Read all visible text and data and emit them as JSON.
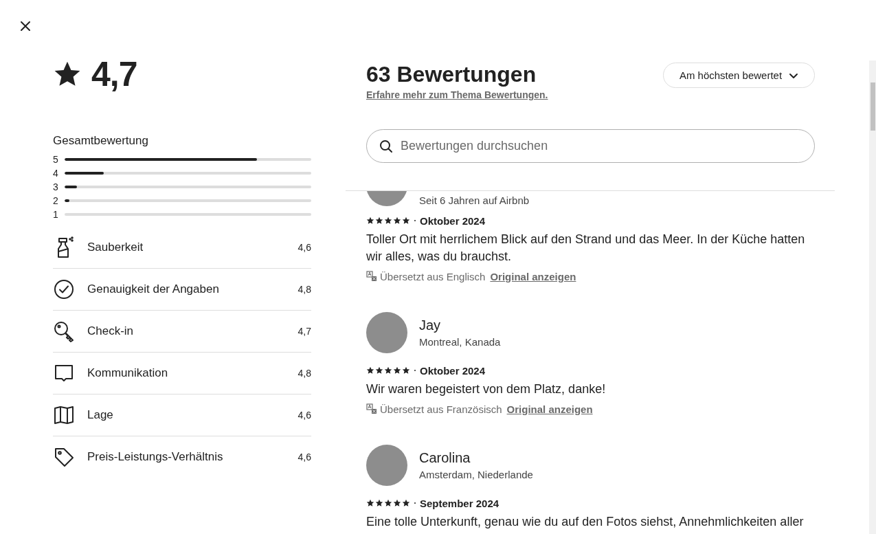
{
  "summary": {
    "rating": "4,7",
    "distribution_title": "Gesamtbewertung",
    "distribution": [
      {
        "label": "5",
        "level": 0.78
      },
      {
        "label": "4",
        "level": 0.16
      },
      {
        "label": "3",
        "level": 0.05
      },
      {
        "label": "2",
        "level": 0.02
      },
      {
        "label": "1",
        "level": 0
      }
    ]
  },
  "categories": [
    {
      "label": "Sauberkeit",
      "score": "4,6"
    },
    {
      "label": "Genauigkeit der Angaben",
      "score": "4,8"
    },
    {
      "label": "Check-in",
      "score": "4,7"
    },
    {
      "label": "Kommunikation",
      "score": "4,8"
    },
    {
      "label": "Lage",
      "score": "4,6"
    },
    {
      "label": "Preis-Leistungs-Verhältnis",
      "score": "4,6"
    }
  ],
  "reviews_header": {
    "title": "63 Bewertungen",
    "link": "Erfahre mehr zum Thema Bewertungen.",
    "sort": {
      "label": "Am höchsten bewertet"
    },
    "search": {
      "placeholder": "Bewertungen durchsuchen"
    }
  },
  "reviews": [
    {
      "subtitle": "Seit 6 Jahren auf Airbnb",
      "stars": 5,
      "date": "Oktober 2024",
      "text": "Toller Ort mit herrlichem Blick auf den Strand und das Meer. In der Küche hatten wir alles, was du brauchst.",
      "translation": {
        "note": "Übersetzt aus Englisch",
        "link": "Original anzeigen"
      }
    },
    {
      "name": "Jay",
      "subtitle": "Montreal, Kanada",
      "stars": 5,
      "date": "Oktober 2024",
      "text": "Wir waren begeistert von dem Platz, danke!",
      "translation": {
        "note": "Übersetzt aus Französisch",
        "link": "Original anzeigen"
      }
    },
    {
      "name": "Carolina",
      "subtitle": "Amsterdam, Niederlande",
      "stars": 5,
      "date": "September 2024",
      "text": "Eine tolle Unterkunft, genau wie du auf den Fotos siehst, Annehmlichkeiten aller"
    }
  ]
}
